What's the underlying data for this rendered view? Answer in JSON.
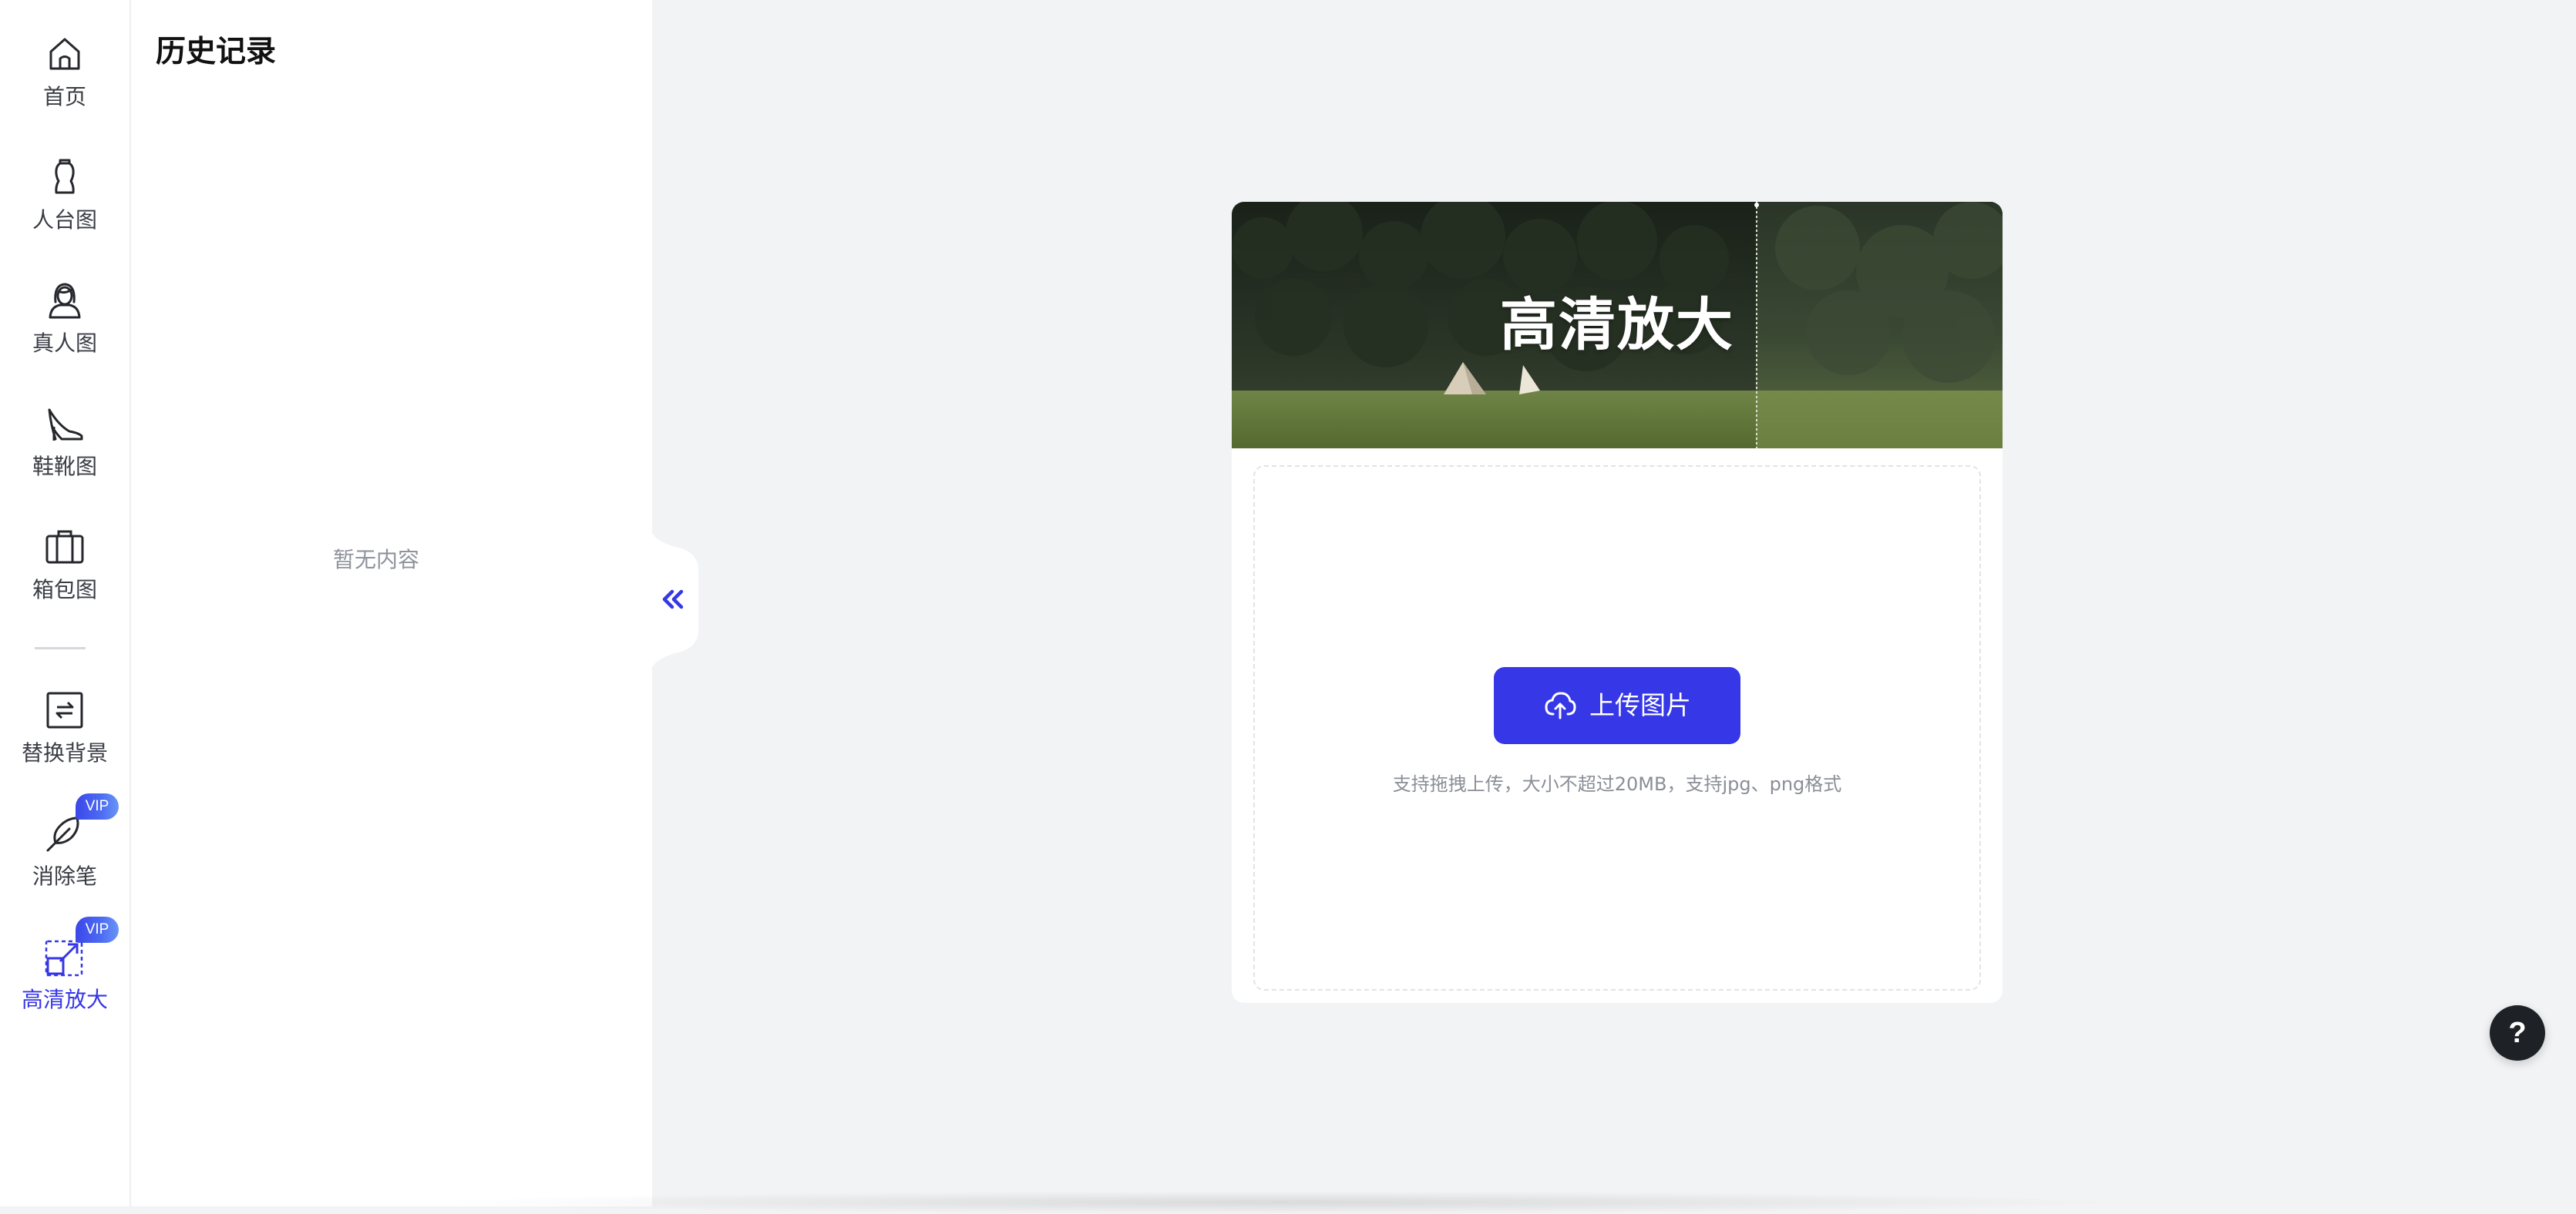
{
  "nav": {
    "items": [
      {
        "label": "首页",
        "icon": "home-icon"
      },
      {
        "label": "人台图",
        "icon": "mannequin-icon"
      },
      {
        "label": "真人图",
        "icon": "person-icon"
      },
      {
        "label": "鞋靴图",
        "icon": "high-heel-icon"
      },
      {
        "label": "箱包图",
        "icon": "suitcase-icon"
      },
      {
        "label": "替换背景",
        "icon": "swap-background-icon"
      },
      {
        "label": "消除笔",
        "icon": "feather-pen-icon",
        "badge": "VIP"
      },
      {
        "label": "高清放大",
        "icon": "upscale-icon",
        "badge": "VIP",
        "active": true
      }
    ]
  },
  "history": {
    "title": "历史记录",
    "empty_text": "暂无内容"
  },
  "collapse_icon": "double-chevron-left-icon",
  "card": {
    "banner_title": "高清放大",
    "upload_label": "上传图片",
    "upload_icon": "cloud-upload-icon",
    "hint": "支持拖拽上传，大小不超过20MB，支持jpg、png格式"
  },
  "help": {
    "label": "?"
  },
  "colors": {
    "accent": "#3637e6",
    "background": "#f2f3f5",
    "help_button": "#1e2126"
  }
}
